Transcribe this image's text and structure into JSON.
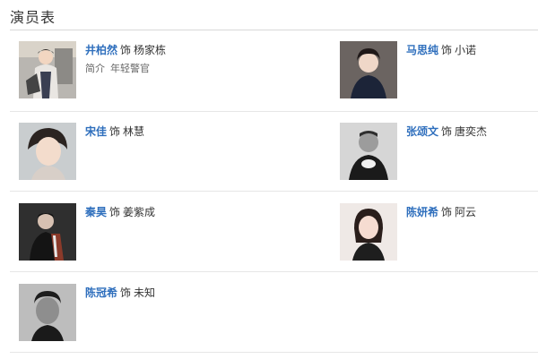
{
  "title": "演员表",
  "connector": "饰",
  "cast": [
    {
      "actor": "井柏然",
      "role": "杨家栋",
      "intro_label": "简介",
      "intro": "年轻警官",
      "icon": "photo-portrait-male-street"
    },
    {
      "actor": "马思纯",
      "role": "小诺",
      "icon": "photo-portrait-female-dark"
    },
    {
      "actor": "宋佳",
      "role": "林慧",
      "icon": "photo-portrait-female-light"
    },
    {
      "actor": "张颂文",
      "role": "唐奕杰",
      "icon": "photo-portrait-male-bw"
    },
    {
      "actor": "秦昊",
      "role": "姜紫成",
      "icon": "photo-portrait-male-scarf"
    },
    {
      "actor": "陈妍希",
      "role": "阿云",
      "icon": "photo-portrait-female-smile"
    },
    {
      "actor": "陈冠希",
      "role": "未知",
      "icon": "photo-portrait-male-bw"
    }
  ]
}
